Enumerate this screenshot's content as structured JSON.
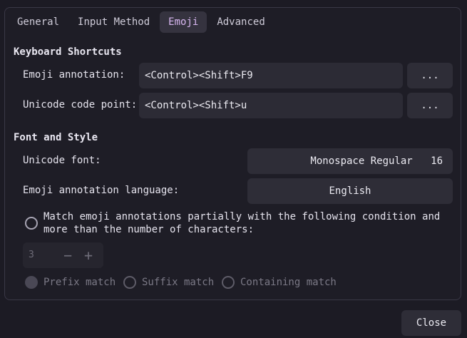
{
  "tabs": [
    {
      "label": "General"
    },
    {
      "label": "Input Method"
    },
    {
      "label": "Emoji"
    },
    {
      "label": "Advanced"
    }
  ],
  "active_tab": "Emoji",
  "shortcuts": {
    "title": "Keyboard Shortcuts",
    "emoji_annotation_label": "Emoji annotation:",
    "emoji_annotation_value": "<Control><Shift>F9",
    "unicode_code_point_label": "Unicode code point:",
    "unicode_code_point_value": "<Control><Shift>u",
    "ellipsis_label": "..."
  },
  "font_style": {
    "title": "Font and Style",
    "unicode_font_label": "Unicode font:",
    "unicode_font_name": "Monospace Regular",
    "unicode_font_size": "16",
    "annotation_language_label": "Emoji annotation language:",
    "annotation_language_value": "English"
  },
  "match": {
    "line1": "Match emoji annotations partially with the following condition and",
    "line2": "more than the number of characters:",
    "enabled": false,
    "min_chars": "3",
    "options": [
      "Prefix match",
      "Suffix match",
      "Containing match"
    ],
    "selected": "Prefix match"
  },
  "footer": {
    "close_label": "Close"
  },
  "colors": {
    "accent": "#d9b8f2",
    "background": "#1c1b24"
  }
}
